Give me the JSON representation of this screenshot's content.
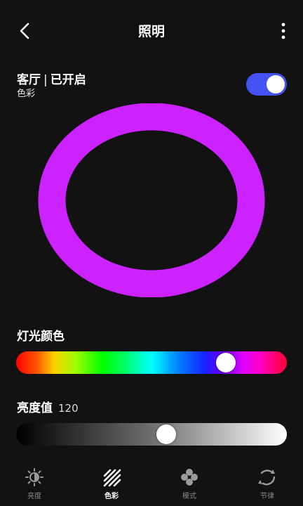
{
  "header": {
    "title": "照明",
    "back_icon": "back-arrow-icon",
    "more_icon": "more-vertical-icon"
  },
  "device": {
    "room_status": "客厅｜已开启",
    "room": "客厅",
    "separator": "|",
    "status": "已开启",
    "mode_label": "色彩",
    "power_on": true
  },
  "color_ring": {
    "color": "#cc22ff"
  },
  "light_color": {
    "label": "灯光颜色",
    "hue_fraction": 0.8
  },
  "brightness": {
    "label": "亮度值",
    "value": "120",
    "fraction": 0.56
  },
  "tabs": [
    {
      "label": "亮度",
      "icon": "brightness-icon",
      "active": false
    },
    {
      "label": "色彩",
      "icon": "color-stripes-icon",
      "active": true
    },
    {
      "label": "模式",
      "icon": "mode-icon",
      "active": false
    },
    {
      "label": "节律",
      "icon": "rhythm-icon",
      "active": false
    }
  ],
  "colors": {
    "accent": "#4352f0",
    "ring": "#cc22ff",
    "background": "#121212"
  }
}
